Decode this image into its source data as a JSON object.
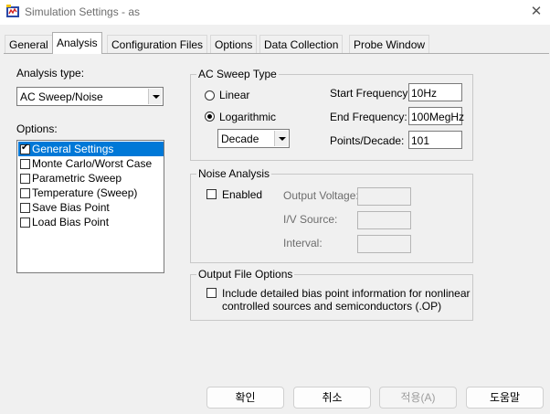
{
  "window": {
    "title": "Simulation Settings - as",
    "icon": "app-icon",
    "close_glyph": "✕"
  },
  "tabs": [
    {
      "label": "General",
      "active": false
    },
    {
      "label": "Analysis",
      "active": true
    },
    {
      "label": "Configuration Files",
      "active": false
    },
    {
      "label": "Options",
      "active": false
    },
    {
      "label": "Data Collection",
      "active": false
    },
    {
      "label": "Probe Window",
      "active": false
    }
  ],
  "analysis": {
    "type_label": "Analysis type:",
    "type_value": "AC Sweep/Noise",
    "options_label": "Options:",
    "options": [
      {
        "label": "General Settings",
        "checked": true,
        "selected": true
      },
      {
        "label": "Monte Carlo/Worst Case",
        "checked": false,
        "selected": false
      },
      {
        "label": "Parametric Sweep",
        "checked": false,
        "selected": false
      },
      {
        "label": "Temperature (Sweep)",
        "checked": false,
        "selected": false
      },
      {
        "label": "Save Bias Point",
        "checked": false,
        "selected": false
      },
      {
        "label": "Load Bias Point",
        "checked": false,
        "selected": false
      }
    ]
  },
  "ac_sweep": {
    "group_title": "AC Sweep Type",
    "linear_label": "Linear",
    "log_label": "Logarithmic",
    "selected": "Logarithmic",
    "log_mode_value": "Decade",
    "start_label": "Start Frequency:",
    "start_value": "10Hz",
    "end_label": "End Frequency:",
    "end_value": "100MegHz",
    "points_label": "Points/Decade:",
    "points_value": "101"
  },
  "noise": {
    "group_title": "Noise Analysis",
    "enabled_label": "Enabled",
    "enabled": false,
    "output_voltage_label": "Output Voltage:",
    "iv_source_label": "I/V Source:",
    "interval_label": "Interval:",
    "output_voltage_value": "",
    "iv_source_value": "",
    "interval_value": ""
  },
  "output_file": {
    "group_title": "Output File Options",
    "checkbox_label_line1": "Include detailed bias point information for nonlinear",
    "checkbox_label_line2": "controlled sources and semiconductors (.OP)",
    "checked": false
  },
  "buttons": {
    "ok": "확인",
    "cancel": "취소",
    "apply": "적용(A)",
    "help": "도움말"
  },
  "colors": {
    "selection": "#0078d7",
    "dialog_bg": "#f0f0f0"
  }
}
